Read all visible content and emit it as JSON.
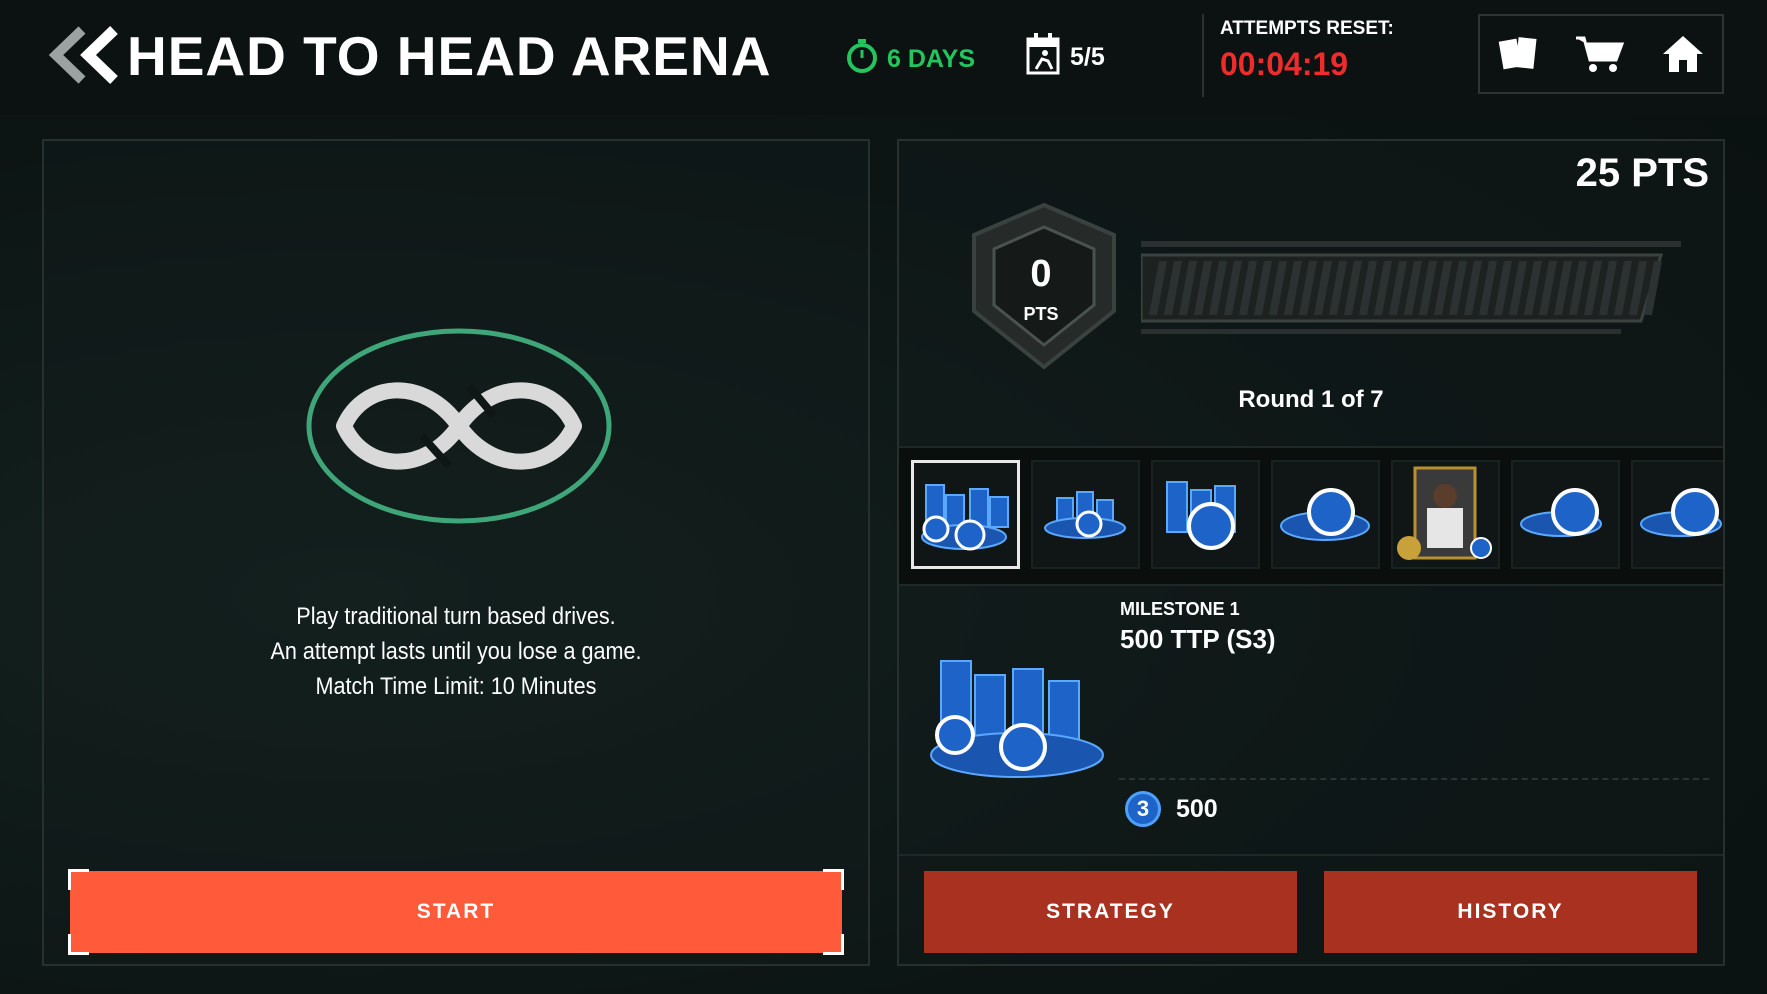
{
  "header": {
    "title": "HEAD TO HEAD ARENA",
    "days_left": "6 DAYS",
    "attempts": "5/5",
    "reset_label": "ATTEMPTS RESET:",
    "reset_time": "00:04:19"
  },
  "left": {
    "description": [
      "Play traditional turn based drives.",
      "An attempt lasts until you lose a game.",
      "Match Time Limit: 10 Minutes"
    ],
    "start_label": "START"
  },
  "right": {
    "total_pts": "25 PTS",
    "current_pts": "0",
    "pts_label": "PTS",
    "progress_fraction": 0.0,
    "round": "Round 1 of 7",
    "milestone_label": "MILESTONE 1",
    "milestone_reward": "500 TTP (S3)",
    "tier": "3",
    "tier_amount": "500",
    "strategy_label": "STRATEGY",
    "history_label": "HISTORY",
    "rewards": [
      {
        "type": "coin-stack-large-icon",
        "selected": true
      },
      {
        "type": "coin-stack-small-icon",
        "selected": false
      },
      {
        "type": "coin-stack-medium-icon",
        "selected": false
      },
      {
        "type": "coin-pile-icon",
        "selected": false
      },
      {
        "type": "player-card-icon",
        "selected": false
      },
      {
        "type": "coin-pile-icon",
        "selected": false
      },
      {
        "type": "coin-pile-icon",
        "selected": false
      }
    ]
  },
  "colors": {
    "accent_green": "#22c55e",
    "timer_red": "#ef2b2b",
    "start_orange": "#ff5a3a",
    "secondary_red": "#a8321f",
    "coin_blue": "#1e63c8"
  }
}
